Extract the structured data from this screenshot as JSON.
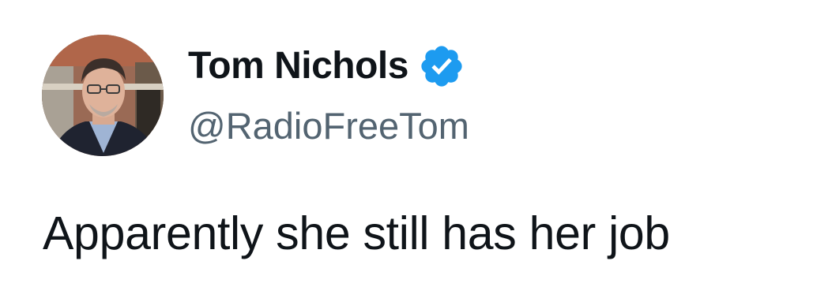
{
  "author": {
    "display_name": "Tom Nichols",
    "handle": "@RadioFreeTom",
    "verified": true,
    "avatar_icon": "profile-photo",
    "badge_icon": "verified-check-icon",
    "badge_color": "#1d9bf0"
  },
  "tweet": {
    "text": "Apparently she still has her job"
  },
  "colors": {
    "text_primary": "#0f1419",
    "text_secondary": "#536471",
    "background": "#ffffff"
  }
}
